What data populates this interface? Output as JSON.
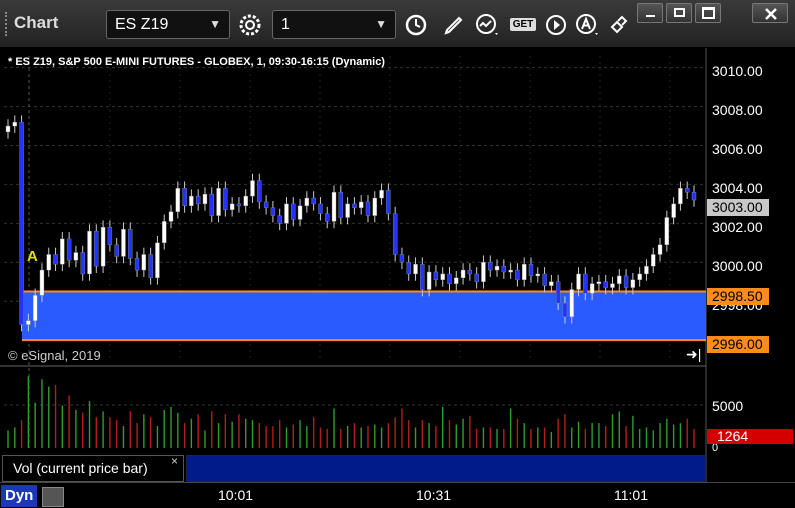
{
  "toolbar": {
    "title": "Chart",
    "symbol": "ES Z19",
    "interval": "1",
    "get_label": "GET"
  },
  "chart_header": "* ES Z19, S&P 500 E-MINI FUTURES - GLOBEX, 1, 09:30-16:15 (Dynamic)",
  "copyright": "© eSignal, 2019",
  "marker_a": "A",
  "price_axis": [
    "3010.00",
    "3008.00",
    "3006.00",
    "3004.00",
    "3002.00",
    "3000.00",
    "2998.00"
  ],
  "price_tags": {
    "last": "3003.00",
    "upper_line": "2998.50",
    "lower_line": "2996.00"
  },
  "volume_axis": {
    "tick": "5000",
    "zero": "0"
  },
  "volume_tag": "1264",
  "study_label": "Vol (current price bar)",
  "study_close": "×",
  "bottom": {
    "dyn": "Dyn",
    "times": [
      "10:01",
      "10:31",
      "11:01"
    ]
  },
  "colors": {
    "up_candle": "#ffffff",
    "down_candle": "#2233ff",
    "zone_fill": "#2a5bff",
    "zone_line": "#ff8c1a",
    "vol_up": "#2e9e2e",
    "vol_down": "#b51d1d"
  },
  "chart_data": {
    "type": "candlestick",
    "ylim": [
      2995.8,
      3010.6
    ],
    "zone": [
      2996.0,
      2998.5
    ],
    "closes": [
      3007.0,
      3007.2,
      2996.8,
      2997.0,
      2998.3,
      2999.6,
      3000.4,
      2999.9,
      3001.2,
      3000.1,
      3000.5,
      2999.4,
      3001.6,
      2999.8,
      3001.8,
      3000.9,
      3000.3,
      3001.7,
      3000.2,
      2999.6,
      3000.4,
      2999.2,
      3001.0,
      3002.1,
      3002.6,
      3003.8,
      3002.9,
      3003.4,
      3003.0,
      3003.5,
      3002.4,
      3003.8,
      3002.7,
      3003.0,
      3002.9,
      3003.4,
      3004.2,
      3003.1,
      3002.8,
      3002.4,
      3002.0,
      3003.0,
      3002.2,
      3002.9,
      3003.3,
      3003.0,
      3002.5,
      3002.1,
      3003.6,
      3002.3,
      3003.0,
      3002.8,
      3003.1,
      3002.4,
      3003.3,
      3003.7,
      3002.5,
      3000.4,
      3000.0,
      2999.4,
      2999.9,
      2998.6,
      2999.5,
      2999.1,
      2999.4,
      2998.9,
      2999.2,
      2999.6,
      2999.4,
      2999.0,
      3000.0,
      2999.6,
      2999.8,
      2999.5,
      2999.6,
      2999.1,
      2999.9,
      2999.3,
      2999.4,
      2998.8,
      2999.0,
      2997.9,
      2997.2,
      2998.6,
      2999.4,
      2998.4,
      2998.9,
      2999.0,
      2998.7,
      2998.9,
      2999.3,
      2998.7,
      2999.1,
      2999.4,
      2999.8,
      3000.4,
      3000.9,
      3002.3,
      3003.0,
      3003.8,
      3003.6,
      3003.2
    ],
    "volumes": [
      1200,
      1400,
      1900,
      4900,
      3100,
      4700,
      4200,
      4300,
      2900,
      3600,
      2600,
      2400,
      3200,
      2100,
      2500,
      2100,
      1900,
      1500,
      2500,
      1700,
      2300,
      2100,
      1500,
      2600,
      2800,
      2400,
      1700,
      2000,
      2300,
      1200,
      2500,
      1700,
      2300,
      1800,
      2300,
      2000,
      1900,
      1700,
      1500,
      1500,
      1900,
      1400,
      1600,
      1900,
      1500,
      2100,
      1400,
      1300,
      2700,
      1300,
      1500,
      1700,
      1400,
      1500,
      1600,
      1400,
      1700,
      2100,
      2700,
      1900,
      1400,
      1900,
      1700,
      1500,
      2800,
      1900,
      1600,
      2000,
      2200,
      1300,
      1400,
      1400,
      1300,
      1300,
      2700,
      2000,
      1700,
      1300,
      1400,
      1400,
      1100,
      2000,
      2300,
      1400,
      1800,
      1300,
      1700,
      1700,
      1500,
      2300,
      2500,
      1500,
      2200,
      1300,
      1400,
      1200,
      1700,
      2000,
      1600,
      1700,
      2000,
      1300
    ]
  }
}
